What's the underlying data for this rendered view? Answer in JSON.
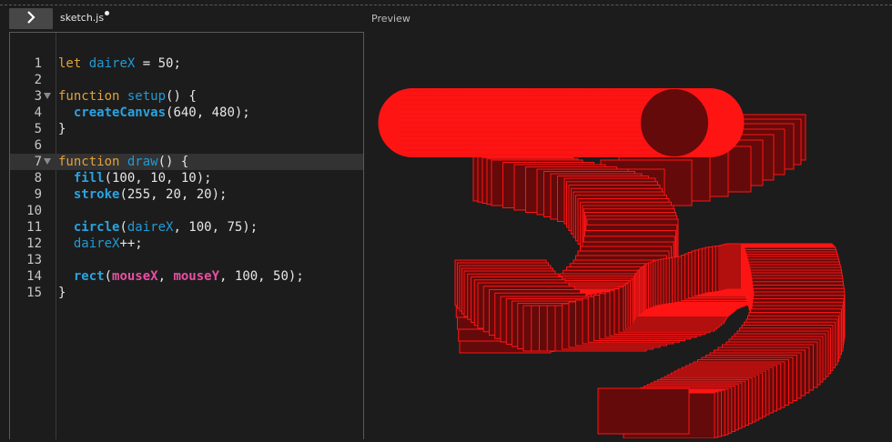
{
  "toolbar": {
    "run_icon": "chevron-right-icon",
    "file_name": "sketch.js",
    "unsaved": true
  },
  "preview": {
    "label": "Preview"
  },
  "editor": {
    "active_line": 7,
    "lines": [
      {
        "n": "1",
        "tokens": [
          [
            "kw",
            "let"
          ],
          [
            "t",
            " "
          ],
          [
            "var",
            "daireX"
          ],
          [
            "t",
            " = 50;"
          ]
        ]
      },
      {
        "n": "2",
        "tokens": []
      },
      {
        "n": "3",
        "fold": true,
        "tokens": [
          [
            "kw",
            "function"
          ],
          [
            "t",
            " "
          ],
          [
            "fn",
            "setup"
          ],
          [
            "t",
            "() {"
          ]
        ]
      },
      {
        "n": "4",
        "tokens": [
          [
            "t",
            "  "
          ],
          [
            "bi",
            "createCanvas"
          ],
          [
            "t",
            "(640, 480);"
          ]
        ]
      },
      {
        "n": "5",
        "tokens": [
          [
            "t",
            "}"
          ]
        ]
      },
      {
        "n": "6",
        "tokens": []
      },
      {
        "n": "7",
        "fold": true,
        "tokens": [
          [
            "kw",
            "function"
          ],
          [
            "t",
            " "
          ],
          [
            "fn",
            "draw"
          ],
          [
            "t",
            "() {"
          ]
        ]
      },
      {
        "n": "8",
        "tokens": [
          [
            "t",
            "  "
          ],
          [
            "bi",
            "fill"
          ],
          [
            "t",
            "(100, 10, 10);"
          ]
        ]
      },
      {
        "n": "9",
        "tokens": [
          [
            "t",
            "  "
          ],
          [
            "bi",
            "stroke"
          ],
          [
            "t",
            "(255, 20, 20);"
          ]
        ]
      },
      {
        "n": "10",
        "tokens": []
      },
      {
        "n": "11",
        "tokens": [
          [
            "t",
            "  "
          ],
          [
            "bi",
            "circle"
          ],
          [
            "t",
            "("
          ],
          [
            "var",
            "daireX"
          ],
          [
            "t",
            ", 100, 75);"
          ]
        ]
      },
      {
        "n": "12",
        "tokens": [
          [
            "t",
            "  "
          ],
          [
            "var",
            "daireX"
          ],
          [
            "t",
            "++;"
          ]
        ]
      },
      {
        "n": "13",
        "tokens": []
      },
      {
        "n": "14",
        "tokens": [
          [
            "t",
            "  "
          ],
          [
            "bi",
            "rect"
          ],
          [
            "t",
            "("
          ],
          [
            "mv",
            "mouseX"
          ],
          [
            "t",
            ", "
          ],
          [
            "mv",
            "mouseY"
          ],
          [
            "t",
            ", 100, 50);"
          ]
        ]
      },
      {
        "n": "15",
        "tokens": [
          [
            "t",
            "}"
          ]
        ]
      }
    ]
  },
  "sketch": {
    "fill_color": "#640a0a",
    "stroke_color": "#ff1414"
  }
}
